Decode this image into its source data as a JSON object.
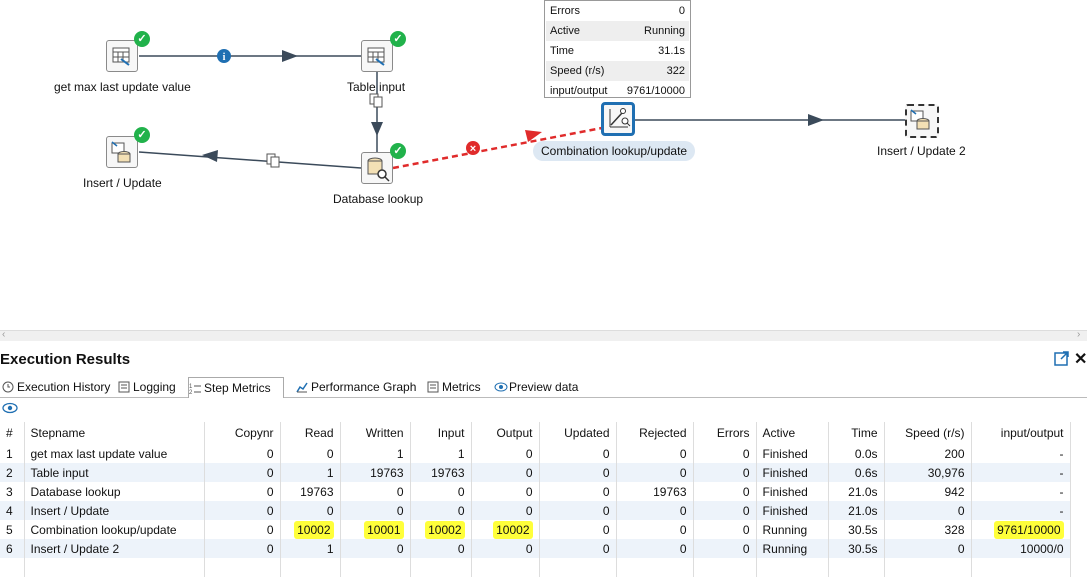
{
  "canvas": {
    "steps": [
      {
        "label": "get max last update value",
        "status": "ok"
      },
      {
        "label": "Table input",
        "status": "ok"
      },
      {
        "label": "Insert / Update",
        "status": "ok"
      },
      {
        "label": "Database lookup",
        "status": "ok"
      },
      {
        "label": "Combination lookup/update",
        "status": "running",
        "selected": true
      },
      {
        "label": "Insert / Update 2",
        "status": "none"
      }
    ],
    "tooltip": {
      "rows": [
        {
          "key": "Errors",
          "value": "0"
        },
        {
          "key": "Active",
          "value": "Running"
        },
        {
          "key": "Time",
          "value": "31.1s"
        },
        {
          "key": "Speed (r/s)",
          "value": "322"
        },
        {
          "key": "input/output",
          "value": "9761/10000"
        }
      ]
    },
    "hop_colors": {
      "normal": "#3b4a5a",
      "error": "#e02b2b",
      "info": "#1f6fb2"
    }
  },
  "panel": {
    "title": "Execution Results",
    "tabs": [
      {
        "label": "Execution History",
        "icon": "history-icon"
      },
      {
        "label": "Logging",
        "icon": "log-icon"
      },
      {
        "label": "Step Metrics",
        "icon": "metrics-list-icon",
        "active": true
      },
      {
        "label": "Performance Graph",
        "icon": "graph-icon"
      },
      {
        "label": "Metrics",
        "icon": "metrics-icon"
      },
      {
        "label": "Preview data",
        "icon": "eye-icon"
      }
    ]
  },
  "table": {
    "columns": [
      "#",
      "Stepname",
      "Copynr",
      "Read",
      "Written",
      "Input",
      "Output",
      "Updated",
      "Rejected",
      "Errors",
      "Active",
      "Time",
      "Speed (r/s)",
      "input/output"
    ],
    "rows": [
      [
        "1",
        "get max last update value",
        "0",
        "0",
        "1",
        "1",
        "0",
        "0",
        "0",
        "0",
        "Finished",
        "0.0s",
        "200",
        "-"
      ],
      [
        "2",
        "Table input",
        "0",
        "1",
        "19763",
        "19763",
        "0",
        "0",
        "0",
        "0",
        "Finished",
        "0.6s",
        "30,976",
        "-"
      ],
      [
        "3",
        "Database lookup",
        "0",
        "19763",
        "0",
        "0",
        "0",
        "0",
        "19763",
        "0",
        "Finished",
        "21.0s",
        "942",
        "-"
      ],
      [
        "4",
        "Insert / Update",
        "0",
        "0",
        "0",
        "0",
        "0",
        "0",
        "0",
        "0",
        "Finished",
        "21.0s",
        "0",
        "-"
      ],
      [
        "5",
        "Combination lookup/update",
        "0",
        "10002",
        "10001",
        "10002",
        "10002",
        "0",
        "0",
        "0",
        "Running",
        "30.5s",
        "328",
        "9761/10000"
      ],
      [
        "6",
        "Insert / Update 2",
        "0",
        "1",
        "0",
        "0",
        "0",
        "0",
        "0",
        "0",
        "Running",
        "30.5s",
        "0",
        "10000/0"
      ]
    ],
    "highlight_color": "#ffff3a"
  }
}
